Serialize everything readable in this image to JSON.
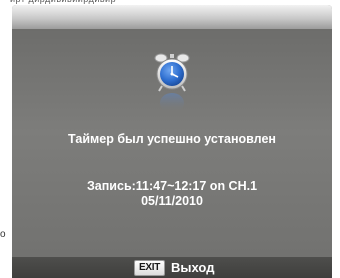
{
  "dialog": {
    "message": "Таймер был успешно установлен",
    "record_line": "Запись:11:47~12:17 on CH.1",
    "date_line": "05/11/2010",
    "icon": "alarm-clock-icon"
  },
  "footer": {
    "exit_key": "EXIT",
    "exit_label": "Выход"
  },
  "colors": {
    "dialog_bg": "#7a7a78",
    "clock_face": "#2f6fd0",
    "text": "#ffffff"
  }
}
